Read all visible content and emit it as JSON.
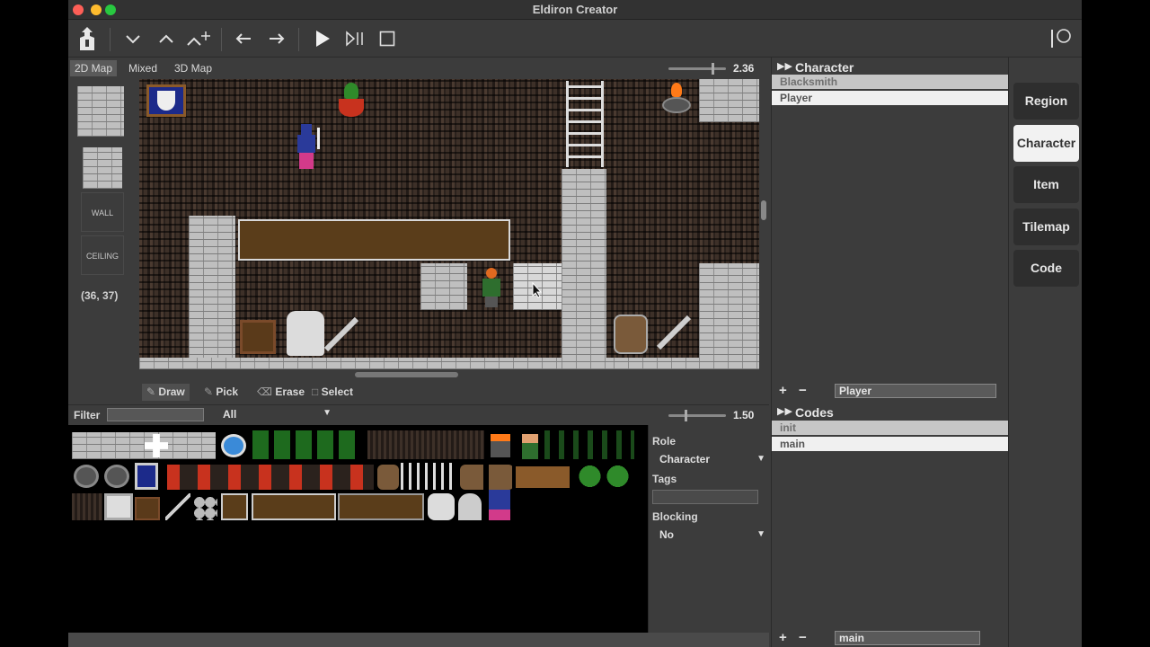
{
  "window": {
    "title": "Eldiron Creator"
  },
  "toolbar": {
    "icons": [
      "app-logo-icon",
      "chevron-down-icon",
      "chevron-up-icon",
      "chevron-up-plus-icon",
      "undo-icon",
      "redo-icon",
      "play-icon",
      "step-icon",
      "stop-icon",
      "sidebar-toggle-icon"
    ]
  },
  "modes": [
    {
      "label": "2D Map",
      "active": true
    },
    {
      "label": "Mixed",
      "active": false
    },
    {
      "label": "3D Map",
      "active": false
    }
  ],
  "map_zoom": "2.36",
  "left_panel": {
    "wall_label": "WALL",
    "ceiling_label": "CEILING",
    "coords": "(36, 37)"
  },
  "tools": [
    {
      "label": "Draw",
      "icon": "pencil-icon",
      "active": true
    },
    {
      "label": "Pick",
      "icon": "picker-icon",
      "active": false
    },
    {
      "label": "Erase",
      "icon": "eraser-icon",
      "active": false
    },
    {
      "label": "Select",
      "icon": "select-icon",
      "active": false
    }
  ],
  "filter": {
    "label": "Filter",
    "value": "",
    "category": "All",
    "zoom": "1.50"
  },
  "properties": {
    "role_label": "Role",
    "role_value": "Character",
    "tags_label": "Tags",
    "tags_value": "",
    "blocking_label": "Blocking",
    "blocking_value": "No"
  },
  "character_section": {
    "title": "Character",
    "items": [
      {
        "label": "Blacksmith",
        "selected": true
      },
      {
        "label": "Player",
        "selected": false
      }
    ],
    "name_field": "Player"
  },
  "codes_section": {
    "title": "Codes",
    "items": [
      {
        "label": "init",
        "selected": true
      },
      {
        "label": "main",
        "selected": false
      }
    ],
    "name_field": "main"
  },
  "sidebar": [
    {
      "label": "Region",
      "active": false
    },
    {
      "label": "Character",
      "active": true
    },
    {
      "label": "Item",
      "active": false
    },
    {
      "label": "Tilemap",
      "active": false
    },
    {
      "label": "Code",
      "active": false
    }
  ],
  "colors": {
    "accent": "#f2f2f2",
    "panel": "#3c3c3c",
    "selected_item": "#c6c6c6"
  }
}
